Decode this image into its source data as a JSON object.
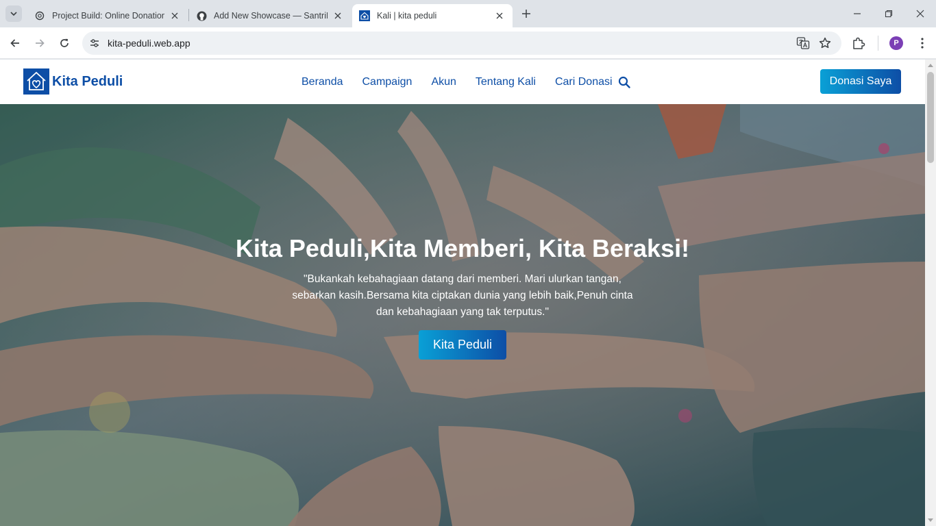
{
  "browser": {
    "tabs": [
      {
        "title": "Project Build: Online Donation",
        "favicon": "openai-icon",
        "active": false
      },
      {
        "title": "Add New Showcase — SantriKoding",
        "favicon": "github-icon",
        "active": false
      },
      {
        "title": "Kali | kita peduli",
        "favicon": "kita-peduli-icon",
        "active": true
      }
    ],
    "url": "kita-peduli.web.app",
    "profile_initial": "P",
    "accent_color": "#7b3fb5"
  },
  "site": {
    "brand": "Kita Peduli",
    "nav": [
      "Beranda",
      "Campaign",
      "Akun",
      "Tentang Kali",
      "Cari Donasi"
    ],
    "cta": "Donasi Saya",
    "brand_color": "#0d4ea6"
  },
  "hero": {
    "title": "Kita Peduli,Kita Memberi, Kita Beraksi!",
    "quote": "\"Bukankah kebahagiaan datang dari memberi. Mari ulurkan tangan, sebarkan kasih.Bersama kita ciptakan dunia yang lebih baik,Penuh cinta dan kebahagiaan yang tak terputus.\"",
    "button": "Kita Peduli",
    "background": "photo of many paint-covered hands stacked together"
  }
}
